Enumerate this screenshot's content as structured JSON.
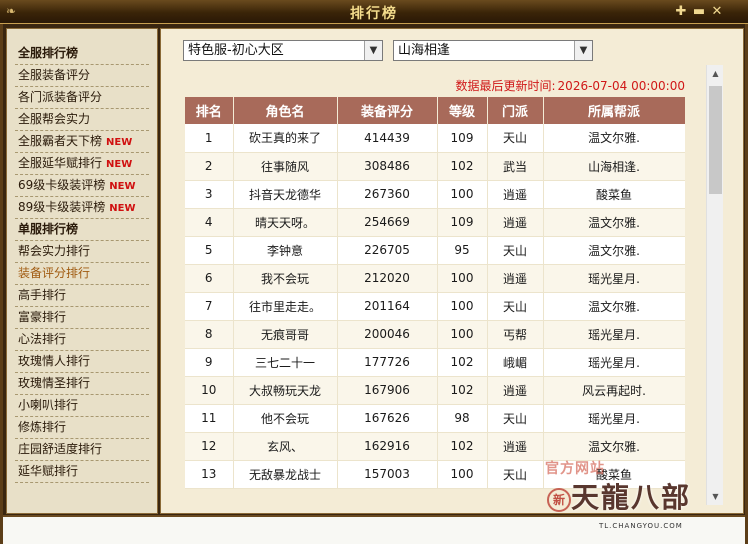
{
  "window": {
    "title": "排行榜"
  },
  "sidebar": {
    "items": [
      {
        "label": "全服排行榜",
        "header": true
      },
      {
        "label": "全服装备评分"
      },
      {
        "label": "各门派装备评分"
      },
      {
        "label": "全服帮会实力"
      },
      {
        "label": "全服霸者天下榜",
        "badge": "NEW"
      },
      {
        "label": "全服延华赋排行",
        "badge": "NEW"
      },
      {
        "label": "69级卡级装评榜",
        "badge": "NEW"
      },
      {
        "label": "89级卡级装评榜",
        "badge": "NEW"
      },
      {
        "label": "单服排行榜",
        "header": true
      },
      {
        "label": "帮会实力排行"
      },
      {
        "label": "装备评分排行",
        "active": true
      },
      {
        "label": "高手排行"
      },
      {
        "label": "富豪排行"
      },
      {
        "label": "心法排行"
      },
      {
        "label": "玫瑰情人排行"
      },
      {
        "label": "玫瑰情圣排行"
      },
      {
        "label": "小喇叭排行"
      },
      {
        "label": "修炼排行"
      },
      {
        "label": "庄园舒适度排行"
      },
      {
        "label": "延华赋排行"
      }
    ]
  },
  "filters": {
    "server": "特色服-初心大区",
    "world": "山海相逢"
  },
  "update": {
    "label": "数据最后更新时间:",
    "time": "2026-07-04 00:00:00"
  },
  "table": {
    "headers": [
      "排名",
      "角色名",
      "装备评分",
      "等级",
      "门派",
      "所属帮派"
    ],
    "rows": [
      [
        "1",
        "砍王真的来了",
        "414439",
        "109",
        "天山",
        "温文尔雅."
      ],
      [
        "2",
        "往事随风",
        "308486",
        "102",
        "武当",
        "山海相逢."
      ],
      [
        "3",
        "抖音天龙德华",
        "267360",
        "100",
        "逍遥",
        "酸菜鱼"
      ],
      [
        "4",
        "晴天天呀。",
        "254669",
        "109",
        "逍遥",
        "温文尔雅."
      ],
      [
        "5",
        "李钟意",
        "226705",
        "95",
        "天山",
        "温文尔雅."
      ],
      [
        "6",
        "我不会玩",
        "212020",
        "100",
        "逍遥",
        "瑶光星月."
      ],
      [
        "7",
        "往市里走走。",
        "201164",
        "100",
        "天山",
        "温文尔雅."
      ],
      [
        "8",
        "无痕哥哥",
        "200046",
        "100",
        "丐帮",
        "瑶光星月."
      ],
      [
        "9",
        "三七二十一",
        "177726",
        "102",
        "峨嵋",
        "瑶光星月."
      ],
      [
        "10",
        "大叔畅玩天龙",
        "167906",
        "102",
        "逍遥",
        "风云再起时."
      ],
      [
        "11",
        "他不会玩",
        "167626",
        "98",
        "天山",
        "瑶光星月."
      ],
      [
        "12",
        "玄风、",
        "162916",
        "102",
        "逍遥",
        "温文尔雅."
      ],
      [
        "13",
        "无敌暴龙战士",
        "157003",
        "100",
        "天山",
        "酸菜鱼"
      ]
    ]
  },
  "logo": {
    "line1": "官方网站",
    "line2": "天龍八部",
    "badge": "新",
    "url": "TL.CHANGYOU.COM"
  },
  "icons": {
    "title_deco": "ornament-icon",
    "pin": "pin-icon",
    "minimize": "minimize-icon",
    "close": "close-icon",
    "dropdown": "chevron-down-icon"
  },
  "colors": {
    "header_bg": "#a86a5a",
    "update_text": "#d01818",
    "new_badge": "#d01010",
    "active_item": "#a05a10"
  }
}
